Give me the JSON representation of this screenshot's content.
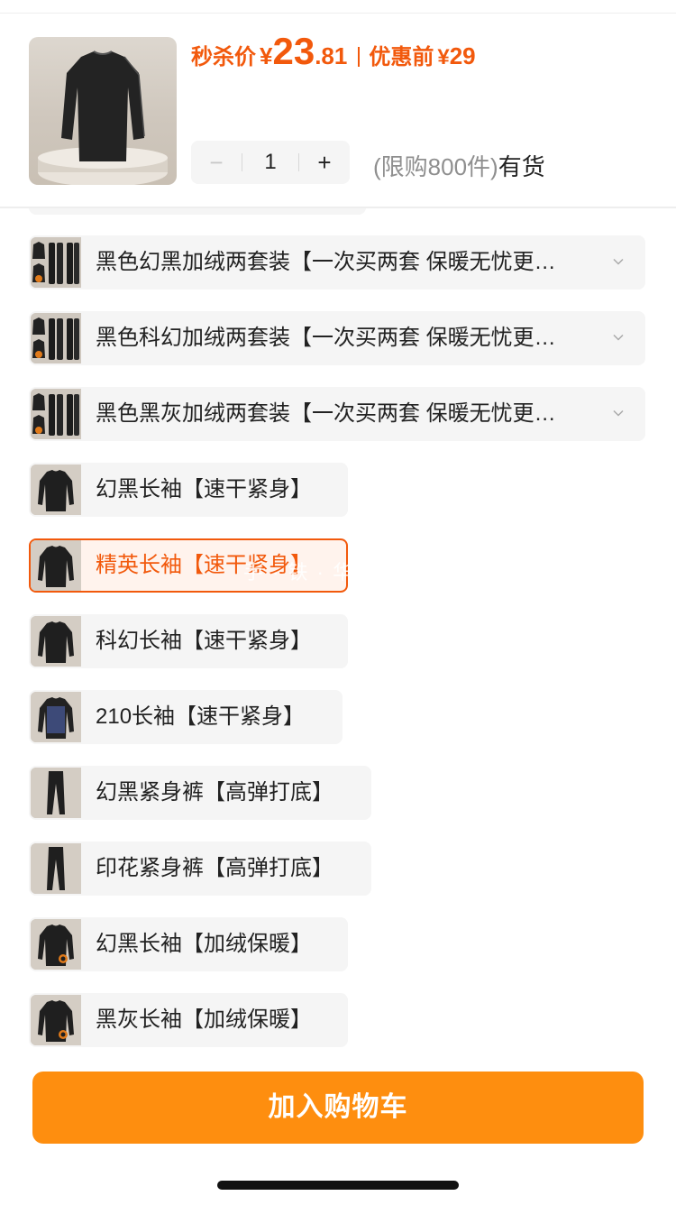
{
  "header": {
    "price_label": "秒杀价",
    "currency": "¥",
    "price_int": "23",
    "price_dec": ".81",
    "orig_label": "优惠前",
    "orig_price": "29"
  },
  "quantity": {
    "minus": "−",
    "value": "1",
    "plus": "+"
  },
  "stock": {
    "limit_text": "(限购800件)",
    "status": "有货"
  },
  "options": [
    {
      "label": "黑色幻黑加绒两套装【一次买两套 保暖无忧更…",
      "thumb": "double-set",
      "expandable": true,
      "selected": false
    },
    {
      "label": "黑色科幻加绒两套装【一次买两套 保暖无忧更…",
      "thumb": "double-set",
      "expandable": true,
      "selected": false
    },
    {
      "label": "黑色黑灰加绒两套装【一次买两套 保暖无忧更…",
      "thumb": "double-set",
      "expandable": true,
      "selected": false
    },
    {
      "label": "幻黑长袖【速干紧身】",
      "thumb": "black-top",
      "expandable": false,
      "selected": false
    },
    {
      "label": "精英长袖【速干紧身】",
      "thumb": "black-top",
      "expandable": false,
      "selected": true
    },
    {
      "label": "科幻长袖【速干紧身】",
      "thumb": "black-top",
      "expandable": false,
      "selected": false
    },
    {
      "label": "210长袖【速干紧身】",
      "thumb": "navy-top",
      "expandable": false,
      "selected": false
    },
    {
      "label": "幻黑紧身裤【高弹打底】",
      "thumb": "pants",
      "expandable": false,
      "selected": false
    },
    {
      "label": "印花紧身裤【高弹打底】",
      "thumb": "pants",
      "expandable": false,
      "selected": false
    },
    {
      "label": "幻黑长袖【加绒保暖】",
      "thumb": "fleece-top",
      "expandable": false,
      "selected": false
    },
    {
      "label": "黑灰长袖【加绒保暖】",
      "thumb": "fleece-top",
      "expandable": false,
      "selected": false
    }
  ],
  "watermark": "手 · 铁 · 华 · 入 · 三 · 万",
  "cart_button": "加入购物车",
  "colors": {
    "accent": "#f2590c",
    "cart_button": "#fe8e0f",
    "chip_bg": "#f5f5f5",
    "selected_bg": "#fff3ed"
  }
}
